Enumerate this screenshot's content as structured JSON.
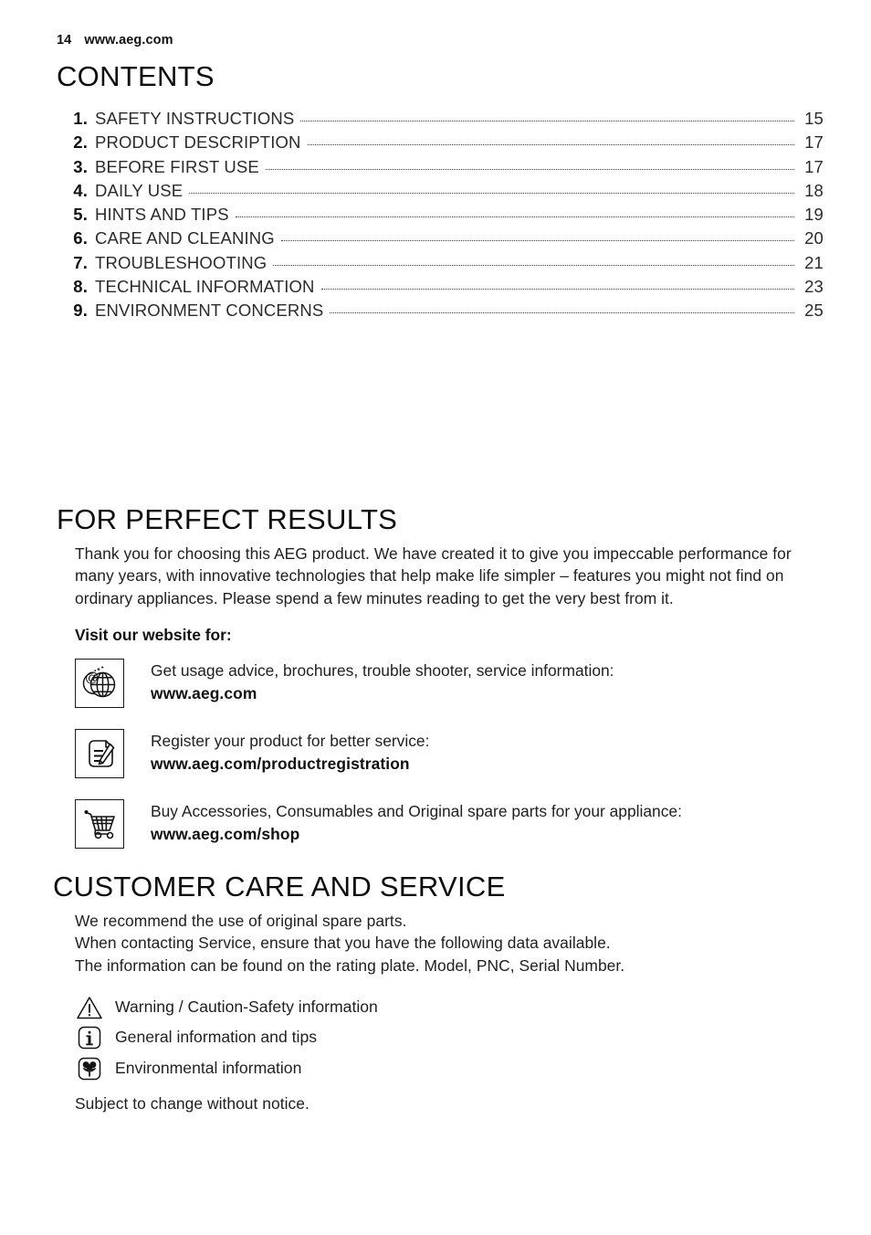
{
  "header": {
    "page_number": "14",
    "website": "www.aeg.com"
  },
  "contents": {
    "heading": "CONTENTS",
    "entries": [
      {
        "num": "1.",
        "title": "SAFETY INSTRUCTIONS",
        "page": "15"
      },
      {
        "num": "2.",
        "title": "PRODUCT DESCRIPTION",
        "page": "17"
      },
      {
        "num": "3.",
        "title": "BEFORE FIRST USE",
        "page": "17"
      },
      {
        "num": "4.",
        "title": "DAILY USE",
        "page": "18"
      },
      {
        "num": "5.",
        "title": "HINTS AND TIPS",
        "page": "19"
      },
      {
        "num": "6.",
        "title": "CARE AND CLEANING",
        "page": "20"
      },
      {
        "num": "7.",
        "title": "TROUBLESHOOTING",
        "page": "21"
      },
      {
        "num": "8.",
        "title": "TECHNICAL INFORMATION",
        "page": "23"
      },
      {
        "num": "9.",
        "title": "ENVIRONMENT CONCERNS",
        "page": "25"
      }
    ]
  },
  "perfect_results": {
    "heading": "FOR PERFECT RESULTS",
    "paragraph": "Thank you for choosing this AEG product. We have created it to give you impeccable performance for many years, with innovative technologies that help make life simpler – features you might not find on ordinary appliances. Please spend a few minutes reading to get the very best from it.",
    "visit_label": "Visit our website for:",
    "links": [
      {
        "icon": "globe-at-icon",
        "description": "Get usage advice, brochures, trouble shooter, service information:",
        "url": "www.aeg.com"
      },
      {
        "icon": "document-pencil-icon",
        "description": "Register your product for better service:",
        "url": "www.aeg.com/productregistration"
      },
      {
        "icon": "shopping-cart-icon",
        "description": "Buy Accessories, Consumables and Original spare parts for your appliance:",
        "url": "www.aeg.com/shop"
      }
    ]
  },
  "customer_care": {
    "heading": "CUSTOMER CARE AND SERVICE",
    "lines": [
      "We recommend the use of original spare parts.",
      "When contacting Service, ensure that you have the following data available.",
      "The information can be found on the rating plate. Model, PNC, Serial Number."
    ],
    "legend": [
      {
        "icon": "warning-triangle-icon",
        "label": "Warning / Caution-Safety information"
      },
      {
        "icon": "info-icon",
        "label": "General information and tips"
      },
      {
        "icon": "environment-icon",
        "label": "Environmental information"
      }
    ],
    "notice": "Subject to change without notice."
  },
  "colors": {
    "text": "#1a1a1a",
    "muted": "#2b2b2b",
    "background": "#ffffff"
  }
}
